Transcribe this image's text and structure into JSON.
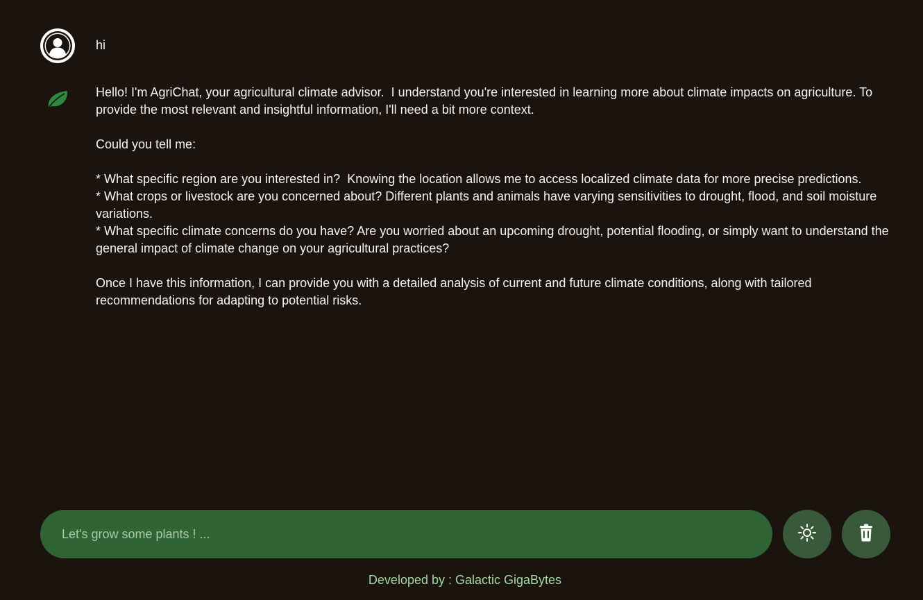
{
  "messages": [
    {
      "role": "user",
      "avatar_icon": "user-avatar-icon",
      "text": "hi"
    },
    {
      "role": "bot",
      "avatar_icon": "leaf-icon",
      "text": "Hello! I'm AgriChat, your agricultural climate advisor.  I understand you're interested in learning more about climate impacts on agriculture. To provide the most relevant and insightful information, I'll need a bit more context.\n\nCould you tell me:\n\n* What specific region are you interested in?  Knowing the location allows me to access localized climate data for more precise predictions.\n* What crops or livestock are you concerned about? Different plants and animals have varying sensitivities to drought, flood, and soil moisture variations.\n* What specific climate concerns do you have? Are you worried about an upcoming drought, potential flooding, or simply want to understand the general impact of climate change on your agricultural practices?\n\nOnce I have this information, I can provide you with a detailed analysis of current and future climate conditions, along with tailored recommendations for adapting to potential risks."
    }
  ],
  "input": {
    "placeholder": "Let's grow some plants ! ...",
    "value": ""
  },
  "buttons": {
    "theme_icon": "sun-icon",
    "delete_icon": "trash-icon"
  },
  "footer": {
    "text": "Developed by : Galactic GigaBytes"
  },
  "colors": {
    "background": "#1b130e",
    "input_background": "#306434",
    "button_background": "#385a3b",
    "leaf": "#2e8b3e",
    "footer_text": "#a6d8a6"
  }
}
